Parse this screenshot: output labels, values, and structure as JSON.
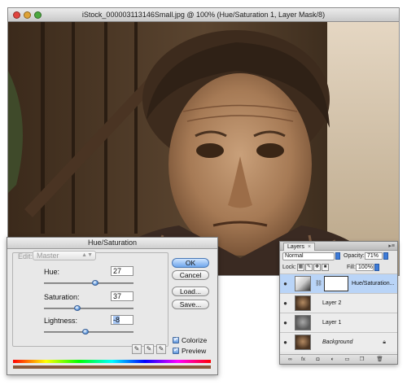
{
  "document": {
    "title": "iStock_000003113146Small.jpg @ 100% (Hue/Saturation 1, Layer Mask/8)",
    "window_controls": [
      "close-icon",
      "minimize-icon",
      "zoom-icon"
    ],
    "photo_description_icon": "portrait-photo",
    "tone_color": "#6b5a48"
  },
  "hue_saturation": {
    "title": "Hue/Saturation",
    "edit_label": "Edit:",
    "edit_value": "Master",
    "hue_label": "Hue:",
    "hue_value": "27",
    "saturation_label": "Saturation:",
    "saturation_value": "37",
    "lightness_label": "Lightness:",
    "lightness_value": "-8",
    "hue_range": [
      -180,
      180
    ],
    "saturation_range": [
      0,
      100
    ],
    "lightness_range": [
      -100,
      100
    ],
    "ok_label": "OK",
    "cancel_label": "Cancel",
    "load_label": "Load...",
    "save_label": "Save...",
    "colorize_label": "Colorize",
    "colorize_checked": true,
    "preview_label": "Preview",
    "preview_checked": true,
    "eyedroppers": [
      "eyedropper-icon",
      "eyedropper-plus-icon",
      "eyedropper-minus-icon"
    ],
    "result_color": "#8a5a3c"
  },
  "layers_panel": {
    "tab_label": "Layers",
    "tab_close": "×",
    "blend_mode": "Normal",
    "opacity_label": "Opacity:",
    "opacity_value": "71%",
    "lock_label": "Lock:",
    "fill_label": "Fill:",
    "fill_value": "100%",
    "layers": [
      {
        "name": "Hue/Saturation...",
        "type": "adjustment",
        "selected": true,
        "visible": true
      },
      {
        "name": "Layer 2",
        "type": "image",
        "selected": false,
        "visible": true
      },
      {
        "name": "Layer 1",
        "type": "image",
        "selected": false,
        "visible": true
      },
      {
        "name": "Background",
        "type": "image",
        "selected": false,
        "visible": true,
        "locked": true
      }
    ],
    "footer_icons": [
      "link-icon",
      "fx-icon",
      "mask-icon",
      "adjustment-icon",
      "group-icon",
      "new-layer-icon",
      "trash-icon"
    ],
    "selected_color": "#b9d4f7"
  }
}
